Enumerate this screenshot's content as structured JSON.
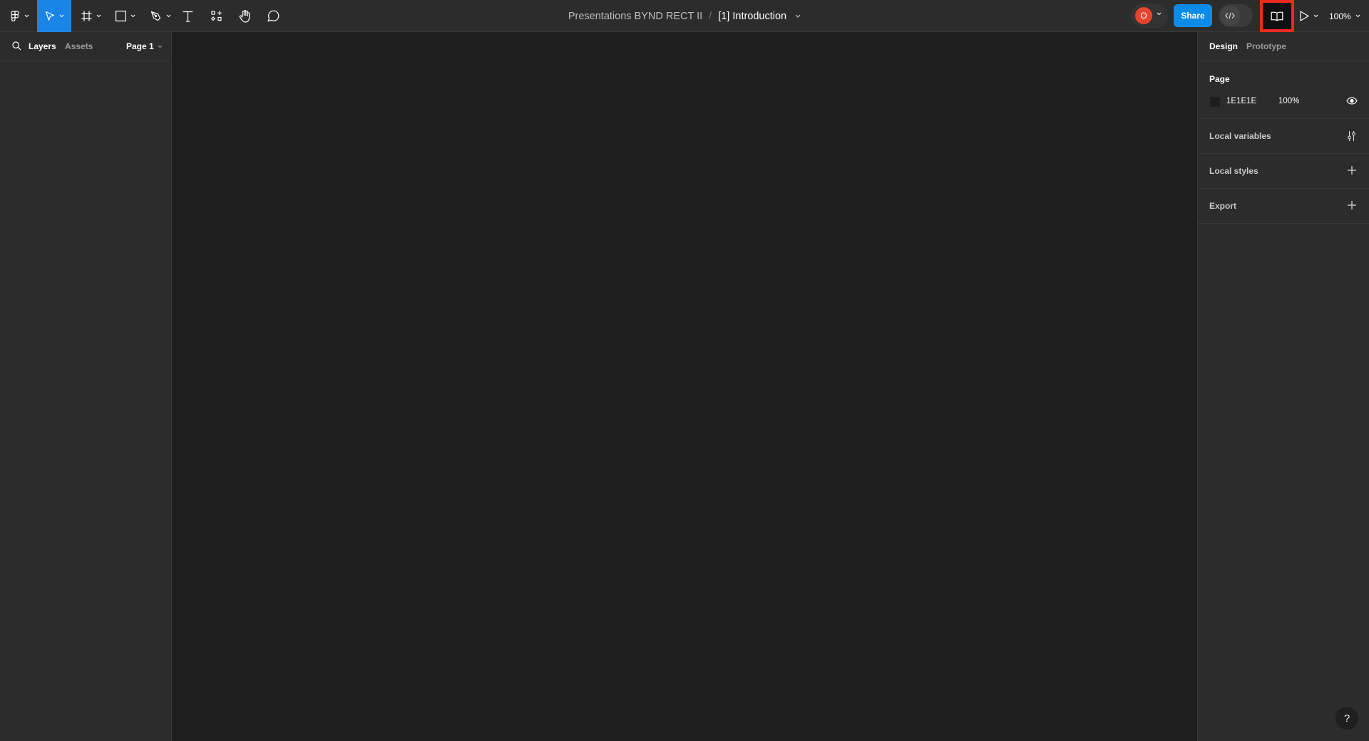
{
  "toolbar": {
    "tools": [
      {
        "name": "main-menu",
        "icon": "figma-logo-icon",
        "has_dropdown": true
      },
      {
        "name": "move-tool",
        "icon": "cursor-arrow-icon",
        "has_dropdown": true,
        "active": true
      },
      {
        "name": "frame-tool",
        "icon": "frame-hash-icon",
        "has_dropdown": true
      },
      {
        "name": "shape-tool",
        "icon": "rectangle-icon",
        "has_dropdown": true
      },
      {
        "name": "pen-tool",
        "icon": "pen-nib-icon",
        "has_dropdown": true
      },
      {
        "name": "text-tool",
        "icon": "text-t-icon",
        "has_dropdown": false
      },
      {
        "name": "resources-tool",
        "icon": "components-icon",
        "has_dropdown": false
      },
      {
        "name": "hand-tool",
        "icon": "hand-icon",
        "has_dropdown": false
      },
      {
        "name": "comment-tool",
        "icon": "speech-bubble-icon",
        "has_dropdown": false
      }
    ],
    "project_name": "Presentations BYND RECT II",
    "separator": "/",
    "page_name": "[1] Introduction",
    "avatar_initial": "O",
    "share_label": "Share",
    "zoom_level": "100%"
  },
  "left_panel": {
    "tabs": [
      "Layers",
      "Assets"
    ],
    "active_tab": "Layers",
    "page_selector": "Page 1"
  },
  "right_panel": {
    "tabs": [
      "Design",
      "Prototype"
    ],
    "active_tab": "Design",
    "page_section": {
      "title": "Page",
      "background_hex": "1E1E1E",
      "background_opacity": "100%"
    },
    "sections": [
      {
        "title": "Local variables",
        "icon": "sliders-icon"
      },
      {
        "title": "Local styles",
        "icon": "plus-icon"
      },
      {
        "title": "Export",
        "icon": "plus-icon"
      }
    ]
  },
  "help_label": "?",
  "colors": {
    "accent": "#0C8CE9",
    "active_tool": "#1A85E6",
    "avatar": "#E5452E",
    "highlight_box": "#EC2A22",
    "canvas": "#1E1E1E",
    "panel": "#2C2C2C"
  }
}
